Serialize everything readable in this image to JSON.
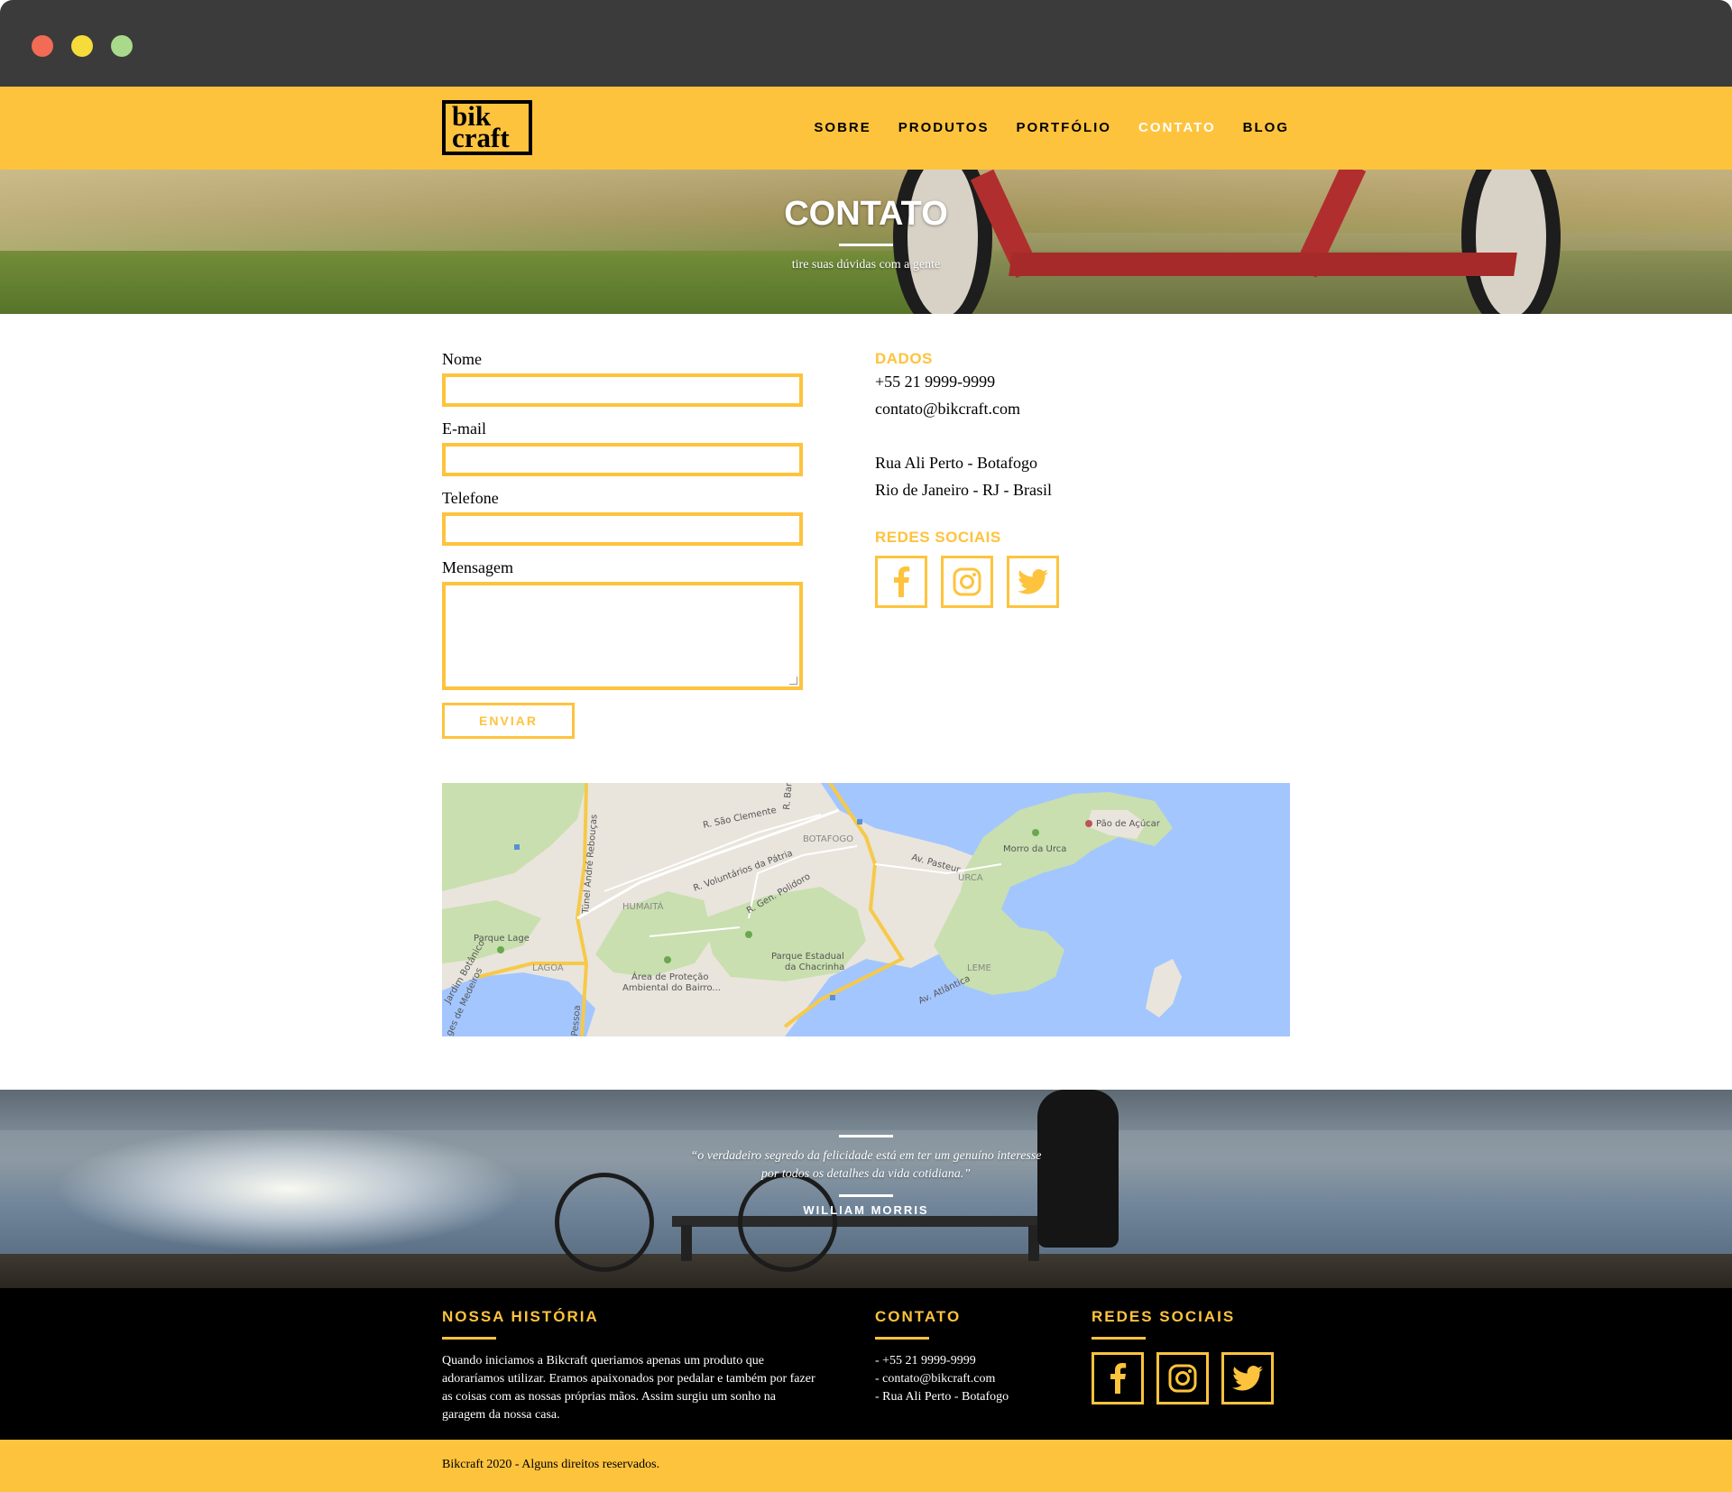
{
  "browser": {
    "buttons": [
      "close",
      "minimize",
      "maximize"
    ]
  },
  "header": {
    "logo_line1": "bik",
    "logo_line2": "craft",
    "nav": [
      {
        "label": "SOBRE"
      },
      {
        "label": "PRODUTOS"
      },
      {
        "label": "PORTFÓLIO"
      },
      {
        "label": "CONTATO",
        "active": true
      },
      {
        "label": "BLOG"
      }
    ]
  },
  "hero": {
    "title": "CONTATO",
    "subtitle": "tire suas dúvidas com a gente"
  },
  "form": {
    "name_label": "Nome",
    "email_label": "E-mail",
    "phone_label": "Telefone",
    "message_label": "Mensagem",
    "name_value": "",
    "email_value": "",
    "phone_value": "",
    "message_value": "",
    "submit_label": "ENVIAR"
  },
  "dados": {
    "title": "DADOS",
    "phone": "+55 21 9999-9999",
    "email": "contato@bikcraft.com",
    "address_line1": "Rua Ali Perto - Botafogo",
    "address_line2": "Rio de Janeiro - RJ - Brasil",
    "social_title": "REDES SOCIAIS",
    "social": [
      "facebook-icon",
      "instagram-icon",
      "twitter-icon"
    ]
  },
  "map": {
    "labels": {
      "clemente": "R. São Clemente",
      "patria": "R. Voluntários da Pátria",
      "botafogo": "BOTAFOGO",
      "humaita": "HUMAITÁ",
      "polidoro": "R. Gen. Polidoro",
      "reboucas": "Túnel André Rebouças",
      "parque_lage": "Parque Lage",
      "lagoa": "LAGOA",
      "botanico": "Jardim Botânico",
      "protecao1": "Área de Proteção",
      "protecao2": "Ambiental do Bairro...",
      "chacrinha1": "Parque Estadual",
      "chacrinha2": "da Chacrinha",
      "pasteur": "Av. Pasteur",
      "urca": "URCA",
      "morro_urca": "Morro da Urca",
      "pao_acucar": "Pão de Açúcar",
      "leme": "LEME",
      "atlantica": "Av. Atlântica",
      "bam": "R. Bam",
      "medeiros": "ges de Medeiros",
      "pessoa": "Pessoa"
    }
  },
  "quote": {
    "text": "“o verdadeiro segredo da felicidade está em ter um genuíno interesse por todos os detalhes da vida cotidiana.”",
    "author": "WILLIAM MORRIS"
  },
  "footer": {
    "history_title": "NOSSA HISTÓRIA",
    "history_text": "Quando iniciamos a Bikcraft queriamos apenas um produto que adoraríamos utilizar. Eramos apaixonados por pedalar e também por fazer as coisas com as nossas próprias mãos. Assim surgiu um sonho na garagem da nossa casa.",
    "contact_title": "CONTATO",
    "contact_lines": [
      "- +55 21 9999-9999",
      "- contato@bikcraft.com",
      "- Rua Ali Perto - Botafogo"
    ],
    "social_title": "REDES SOCIAIS",
    "copyright": "Bikcraft 2020 - Alguns direitos reservados."
  },
  "colors": {
    "accent": "#fec33d",
    "dark": "#000000",
    "water": "#a3c6ff",
    "park": "#c9dfaf"
  }
}
